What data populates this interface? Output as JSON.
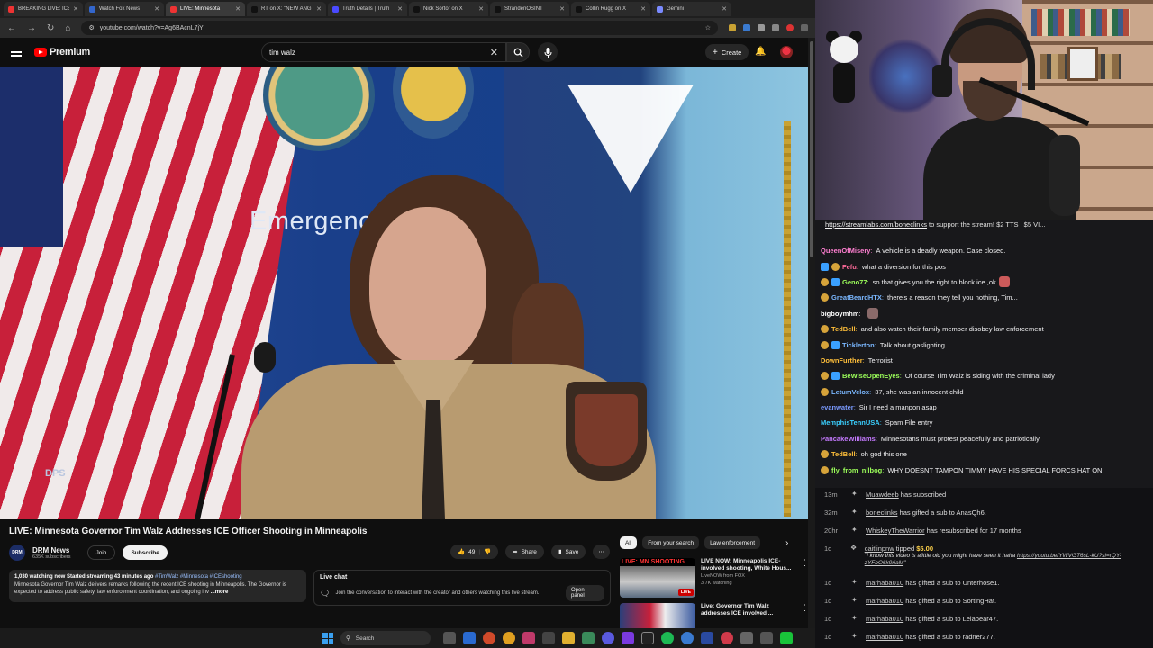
{
  "browser": {
    "tabs": [
      {
        "label": "BREAKING LIVE: ICE",
        "color": "#e33"
      },
      {
        "label": "Watch Fox News",
        "color": "#36c"
      },
      {
        "label": "LIVE: Minnesota",
        "color": "#e33",
        "active": true
      },
      {
        "label": "RT on X: \"NEW ANG",
        "color": "#111"
      },
      {
        "label": "Truth Details | Truth",
        "color": "#4a4aff"
      },
      {
        "label": "Nick Sortor on X",
        "color": "#111"
      },
      {
        "label": "StrandenOSINT",
        "color": "#111"
      },
      {
        "label": "Collin Rugg on X",
        "color": "#111"
      },
      {
        "label": "Gemini",
        "color": "#7a8aff"
      }
    ],
    "url": "youtube.com/watch?v=Ag6BAcnL7jY"
  },
  "yt": {
    "logo_text": "Premium",
    "search_value": "tim walz",
    "create_label": "Create"
  },
  "video": {
    "bg_caption": "Emergency",
    "dps_label": "DPS",
    "title": "LIVE: Minnesota Governor Tim Walz Addresses ICE Officer Shooting in Minneapolis",
    "channel": {
      "name": "DRM News",
      "subs": "635K subscribers",
      "avatar_text": "DRM"
    },
    "join_label": "Join",
    "subscribe_label": "Subscribe",
    "likes": "49",
    "share_label": "Share",
    "save_label": "Save",
    "desc_stats": "1,030 watching now  Started streaming 43 minutes ago",
    "desc_tags": "#TimWalz #Minnesota #ICEshooting",
    "desc_text": "Minnesota Governor Tim Walz delivers remarks following the recent ICE shooting in Minneapolis. The Governor is expected to address public safety, law enforcement coordination, and ongoing inv",
    "desc_more": "...more"
  },
  "livechat": {
    "title": "Live chat",
    "text": "Join the conversation to interact with the creator and others watching this live stream.",
    "open_label": "Open panel"
  },
  "chips": [
    "All",
    "From your search",
    "Law enforcement"
  ],
  "recs": [
    {
      "thumb_headline": "LIVE: MN SHOOTING",
      "live_badge": "LIVE",
      "title": "LIVE NOW: Minneapolis ICE-involved shooting, White Hous...",
      "channel": "LiveNOW from FOX",
      "meta": "3.7K watching"
    },
    {
      "thumb_headline": "",
      "live_badge": "",
      "title": "Live: Governor Tim Walz addresses ICE involved ...",
      "channel": "",
      "meta": ""
    }
  ],
  "taskbar": {
    "search_label": "Search"
  },
  "chat": {
    "banner_link": "https://streamlabs.com/boneclinks",
    "banner_text": " to support the stream! $2 TTS | $5 VI...",
    "messages": [
      {
        "user": "QueenOfMisery",
        "color": "#ff7fd1",
        "text": "A vehicle is a deadly weapon. Case closed.",
        "badges": []
      },
      {
        "user": "Fefu",
        "color": "#ff6a9a",
        "text": "what a diversion for this pos",
        "badges": [
          "blue",
          "gold"
        ]
      },
      {
        "user": "Geno77",
        "color": "#9cff5a",
        "text": "so that gives you the right to block ice ,ok",
        "badges": [
          "gold",
          "blue"
        ],
        "emote": "#cc5a5a"
      },
      {
        "user": "GreatBeardHTX",
        "color": "#7ab7ff",
        "text": "there's a reason they tell you nothing, Tim...",
        "badges": [
          "gold"
        ]
      },
      {
        "user": "bigboymhm",
        "color": "#ffffff",
        "text": "",
        "badges": [],
        "emote": "#8a6a6a"
      },
      {
        "user": "TedBell",
        "color": "#ffbf3a",
        "text": "and also watch their family member disobey law enforcement",
        "badges": [
          "gold"
        ]
      },
      {
        "user": "Ticklerton",
        "color": "#7ab7ff",
        "text": "Talk about gaslighting",
        "badges": [
          "gold",
          "blue"
        ]
      },
      {
        "user": "DownFurther",
        "color": "#ffbf3a",
        "text": "Terrorist",
        "badges": []
      },
      {
        "user": "BeWiseOpenEyes",
        "color": "#9cff5a",
        "text": "Of course Tim Walz is siding with the criminal lady",
        "badges": [
          "gold",
          "blue"
        ]
      },
      {
        "user": "LetumVelox",
        "color": "#7ab7ff",
        "text": "37, she was an innocent child",
        "badges": [
          "gold"
        ]
      },
      {
        "user": "evanwater",
        "color": "#7a9aff",
        "text": "Sir I need a manpon asap",
        "badges": []
      },
      {
        "user": "MemphisTennUSA",
        "color": "#3ad0ff",
        "text": "Spam File entry",
        "badges": []
      },
      {
        "user": "PancakeWilliams",
        "color": "#c57aff",
        "text": "Minnesotans must protest peacefully and patriotically",
        "badges": []
      },
      {
        "user": "TedBell",
        "color": "#ffbf3a",
        "text": "oh god this one",
        "badges": [
          "gold"
        ]
      },
      {
        "user": "fly_from_nilbog",
        "color": "#9cff5a",
        "text": "WHY DOESNT TAMPON TIMMY HAVE HIS SPECIAL FORCS HAT ON",
        "badges": [
          "gold"
        ]
      }
    ],
    "events": [
      {
        "time": "13m",
        "user": "Muawdeeb",
        "text": " has subscribed"
      },
      {
        "time": "32m",
        "user": "boneclinks",
        "text": " has gifted a sub to ",
        "target": "AnasQh6."
      },
      {
        "time": "20hr",
        "user": "WhiskeyTheWarrior",
        "text": " has resubscribed for 17 months"
      },
      {
        "time": "1d",
        "user": "caitlinpnw",
        "text": " tipped ",
        "amount": "$5.00",
        "tip_msg": "\"I know this video is alittle old you might have seen it haha ",
        "tip_link": "https://youtu.be/YWVGT6sL-kU?si=rQY-zYFbO6k9riaM",
        "tip_end": "\""
      },
      {
        "time": "1d",
        "user": "marhaba010",
        "text": " has gifted a sub to ",
        "target": "Unterhose1."
      },
      {
        "time": "1d",
        "user": "marhaba010",
        "text": " has gifted a sub to ",
        "target": "SortingHat."
      },
      {
        "time": "1d",
        "user": "marhaba010",
        "text": " has gifted a sub to ",
        "target": "Lelabear47."
      },
      {
        "time": "1d",
        "user": "marhaba010",
        "text": " has gifted a sub to ",
        "target": "radner277."
      }
    ]
  }
}
